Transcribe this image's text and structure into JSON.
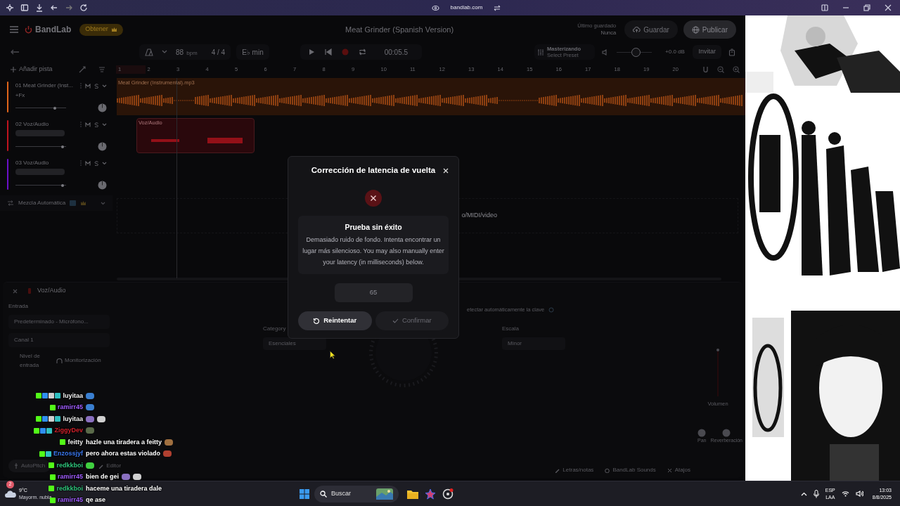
{
  "browser": {
    "url": "bandlab.com"
  },
  "header": {
    "brand": "BandLab",
    "upgrade": "Obtener",
    "title": "Meat Grinder (Spanish Version)",
    "last_saved_label": "Último guardado",
    "last_saved_value": "Nunca",
    "save": "Guardar",
    "publish": "Publicar"
  },
  "toolbar": {
    "tempo": "88",
    "tempo_unit": "bpm",
    "time_signature": "4 / 4",
    "key": "E♭ min",
    "time": "00:05.5",
    "mastering_title": "Masterizando",
    "mastering_preset": "Select Preset",
    "volume": {
      "level": 0.55,
      "reading": "+0.0 dB"
    },
    "invite": "Invitar"
  },
  "ruler": {
    "add_track": "Añadir pista",
    "marks": [
      "1",
      "2",
      "3",
      "4",
      "5",
      "6",
      "7",
      "8",
      "9",
      "10",
      "11",
      "12",
      "13",
      "14",
      "15",
      "16",
      "17",
      "18",
      "19",
      "20"
    ]
  },
  "tracks": [
    {
      "number": "01",
      "name": "Meat Grinder (Inst...",
      "fx": "+Fx",
      "color": "#e0651a",
      "level": 0.8,
      "clip": "Meat Grinder (Instrumental).mp3",
      "kind": "full"
    },
    {
      "number": "02",
      "name": "Voz/Audio",
      "color": "#c0141e",
      "level": 0.95,
      "clip": "Voz/Audio",
      "kind": "short"
    },
    {
      "number": "03",
      "name": "Voz/Audio",
      "color": "#6a10c8",
      "level": 0.95,
      "kind": "empty"
    }
  ],
  "automix": {
    "label": "Mezcla Automática"
  },
  "drop_hint": "o/MIDI/video",
  "bottom_panel": {
    "track": "Voz/Audio",
    "input_label": "Entrada",
    "input_device": "Predeterminado - Micrófono...",
    "channel": "Canal 1",
    "input_level": "Nivel de entrada",
    "monitoring": "Monitorización",
    "detect": "etectar automáticamente la clave",
    "category_label": "Category",
    "category": "Esenciales",
    "scale_label": "Escala",
    "scale": "Minor",
    "volume_label": "Volumen",
    "pan_label": "Pan",
    "reverb_label": "Reverberación",
    "autopitch": "AutoPitch",
    "editor": "Editor",
    "lyrics": "Letras/notas",
    "sounds": "BandLab Sounds",
    "shortcuts": "Atajos"
  },
  "modal": {
    "title": "Corrección de latencia de vuelta",
    "heading": "Prueba sin éxito",
    "message": "Demasiado ruido de fondo. Intenta encontrar un lugar más silencioso. You may also manually enter your latency (in milliseconds) below.",
    "latency": "65",
    "retry": "Reintentar",
    "confirm": "Confirmar",
    "confirm_disabled": true
  },
  "chat": [
    {
      "user": "luyitaa",
      "color": "#f0f0f0",
      "badges": [
        {
          "color": "#53fc18"
        },
        {
          "color": "#2f8ff0"
        },
        {
          "color": "#d0d0d0"
        },
        {
          "color": "#30c0c0"
        }
      ],
      "emotes": [
        {
          "color": "#3a7fd0"
        }
      ]
    },
    {
      "user": "ramirr45",
      "color": "#a05cff",
      "badges": [
        {
          "color": "#53fc18"
        }
      ],
      "emotes": [
        {
          "color": "#3a7fd0"
        }
      ]
    },
    {
      "user": "luyitaa",
      "color": "#f0f0f0",
      "badges": [
        {
          "color": "#53fc18"
        },
        {
          "color": "#2f8ff0"
        },
        {
          "color": "#d0d0d0"
        },
        {
          "color": "#30c0c0"
        }
      ],
      "emotes": [
        {
          "color": "#8a70c0"
        },
        {
          "color": "#d0d0d0"
        }
      ]
    },
    {
      "user": "ZiggyDev",
      "color": "#d0202a",
      "badges": [
        {
          "color": "#53fc18"
        },
        {
          "color": "#2f8ff0"
        },
        {
          "color": "#30c0c0"
        }
      ],
      "emotes": [
        {
          "color": "#5a6a4a"
        }
      ]
    },
    {
      "user": "feitty",
      "color": "#f0f0f0",
      "badges": [
        {
          "color": "#53fc18"
        }
      ],
      "message": "hazle una tiradera a feitty",
      "emotes": [
        {
          "color": "#a07040"
        }
      ]
    },
    {
      "user": "Enzossjyf",
      "color": "#3a78f0",
      "badges": [
        {
          "color": "#53fc18"
        },
        {
          "color": "#30c0c0"
        }
      ],
      "message": "pero ahora estas violado",
      "emotes": [
        {
          "color": "#b04030"
        }
      ]
    },
    {
      "user": "redkkboi",
      "color": "#2ec27a",
      "badges": [
        {
          "color": "#53fc18"
        }
      ],
      "emotes": [
        {
          "color": "#40d040"
        }
      ]
    },
    {
      "user": "ramirr45",
      "color": "#a05cff",
      "badges": [
        {
          "color": "#53fc18"
        }
      ],
      "message": "bien de gei",
      "emotes": [
        {
          "color": "#8a70c0"
        },
        {
          "color": "#d0d0d0"
        }
      ]
    },
    {
      "user": "redkkboi",
      "color": "#2ec27a",
      "badges": [
        {
          "color": "#53fc18"
        }
      ],
      "message": "haceme una tiradera dale"
    },
    {
      "user": "ramirr45",
      "color": "#a05cff",
      "badges": [
        {
          "color": "#53fc18"
        }
      ],
      "message": "qe ase"
    }
  ],
  "taskbar": {
    "weather_temp": "9°C",
    "weather_text": "Mayorm. nubla",
    "notifications": "2",
    "search": "Buscar",
    "language": "ESP",
    "layout": "LAA",
    "time": "13:03",
    "date": "8/8/2025"
  }
}
